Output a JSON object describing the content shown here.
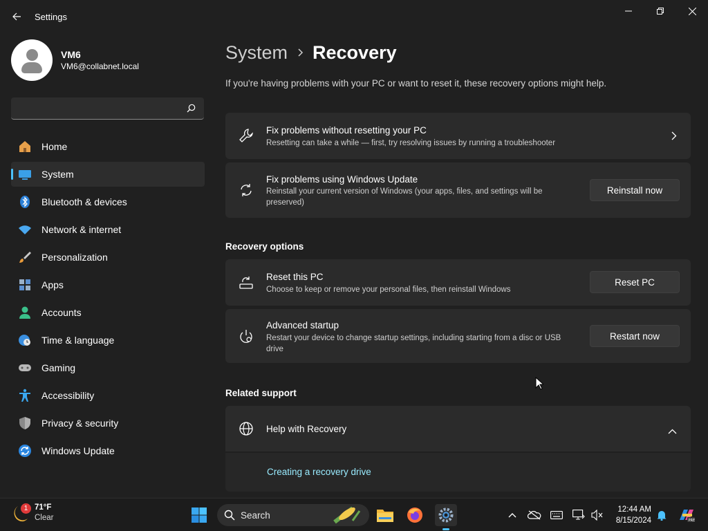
{
  "window": {
    "title": "Settings",
    "back_icon": "back-arrow-icon",
    "controls": [
      "minimize-icon",
      "restore-icon",
      "close-icon"
    ]
  },
  "profile": {
    "name": "VM6",
    "email": "VM6@collabnet.local"
  },
  "search": {
    "placeholder": "",
    "value": ""
  },
  "sidebar": {
    "items": [
      {
        "label": "Home",
        "icon": "home-icon",
        "active": false
      },
      {
        "label": "System",
        "icon": "system-icon",
        "active": true
      },
      {
        "label": "Bluetooth & devices",
        "icon": "bluetooth-icon",
        "active": false
      },
      {
        "label": "Network & internet",
        "icon": "wifi-icon",
        "active": false
      },
      {
        "label": "Personalization",
        "icon": "brush-icon",
        "active": false
      },
      {
        "label": "Apps",
        "icon": "apps-icon",
        "active": false
      },
      {
        "label": "Accounts",
        "icon": "accounts-icon",
        "active": false
      },
      {
        "label": "Time & language",
        "icon": "globe-clock-icon",
        "active": false
      },
      {
        "label": "Gaming",
        "icon": "gamepad-icon",
        "active": false
      },
      {
        "label": "Accessibility",
        "icon": "accessibility-icon",
        "active": false
      },
      {
        "label": "Privacy & security",
        "icon": "shield-icon",
        "active": false
      },
      {
        "label": "Windows Update",
        "icon": "windows-update-icon",
        "active": false
      }
    ]
  },
  "main": {
    "breadcrumb_parent": "System",
    "breadcrumb_current": "Recovery",
    "intro": "If you're having problems with your PC or want to reset it, these recovery options might help.",
    "cards": {
      "fix_no_reset": {
        "title": "Fix problems without resetting your PC",
        "desc": "Resetting can take a while — first, try resolving issues by running a troubleshooter",
        "icon": "wrench-icon"
      },
      "fix_update": {
        "title": "Fix problems using Windows Update",
        "desc": "Reinstall your current version of Windows (your apps, files, and settings will be preserved)",
        "button": "Reinstall now",
        "icon": "refresh-icon"
      }
    },
    "recovery_options_title": "Recovery options",
    "reset_pc": {
      "title": "Reset this PC",
      "desc": "Choose to keep or remove your personal files, then reinstall Windows",
      "button": "Reset PC",
      "icon": "reset-pc-icon"
    },
    "advanced_startup": {
      "title": "Advanced startup",
      "desc": "Restart your device to change startup settings, including starting from a disc or USB drive",
      "button": "Restart now",
      "icon": "advanced-startup-icon"
    },
    "related_support_title": "Related support",
    "help": {
      "title": "Help with Recovery",
      "icon": "globe-icon",
      "link": "Creating a recovery drive"
    }
  },
  "taskbar": {
    "weather_temp": "71°F",
    "weather_cond": "Clear",
    "weather_badge": "1",
    "search_label": "Search",
    "time": "12:44 AM",
    "date": "8/15/2024",
    "apps": [
      "start-icon",
      "search-icon",
      "file-explorer-icon",
      "firefox-icon",
      "settings-icon"
    ],
    "tray": [
      "chevron-up-icon",
      "onedrive-icon",
      "keyboard-icon",
      "display-icon",
      "volume-muted-icon",
      "notification-bell-icon",
      "copilot-icon"
    ]
  },
  "colors": {
    "accent": "#4cc2ff",
    "link": "#99ebff",
    "background": "#202020",
    "card": "#2b2b2b"
  }
}
